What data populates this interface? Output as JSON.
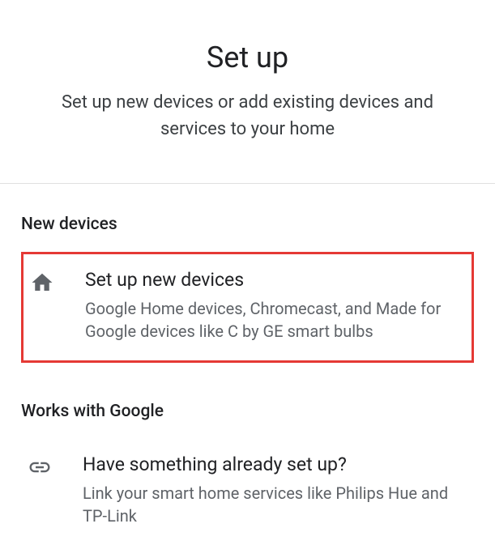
{
  "header": {
    "title": "Set up",
    "subtitle": "Set up new devices or add existing devices and services to your home"
  },
  "sections": {
    "newDevices": {
      "heading": "New devices",
      "item": {
        "title": "Set up new devices",
        "desc": "Google Home devices, Chromecast, and Made for Google devices like C by GE smart bulbs"
      }
    },
    "worksWithGoogle": {
      "heading": "Works with Google",
      "item": {
        "title": "Have something already set up?",
        "desc": "Link your smart home services like Philips Hue and TP-Link"
      }
    }
  }
}
